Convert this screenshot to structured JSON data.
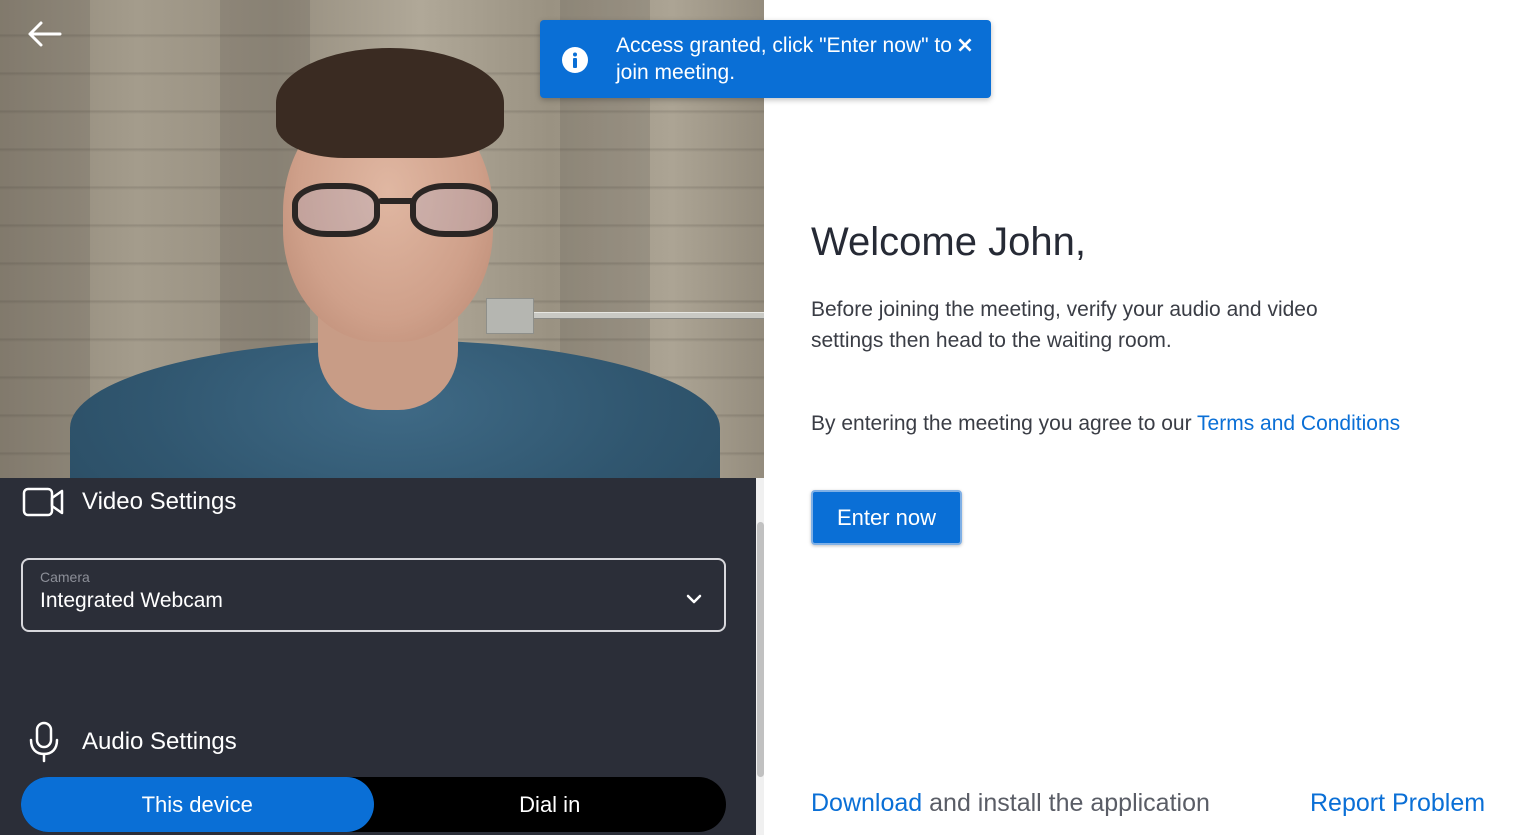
{
  "toast": {
    "message": "Access granted, click \"Enter now\" to join meeting.",
    "close_label": "×"
  },
  "video_settings": {
    "title": "Video Settings",
    "camera_label": "Camera",
    "camera_value": "Integrated Webcam"
  },
  "audio_settings": {
    "title": "Audio Settings",
    "options": [
      "This device",
      "Dial in"
    ],
    "selected": "This device"
  },
  "main": {
    "welcome": "Welcome John,",
    "intro": "Before joining the meeting, verify your audio and video settings then head to the waiting room.",
    "agree_prefix": "By entering the meeting you agree to our ",
    "terms_link": "Terms and Conditions",
    "enter_button": "Enter now"
  },
  "footer": {
    "download_link": "Download",
    "download_suffix": " and install the application",
    "report_link": "Report Problem"
  },
  "colors": {
    "accent": "#0a6fd6",
    "panel_dark": "#2b2e38"
  }
}
